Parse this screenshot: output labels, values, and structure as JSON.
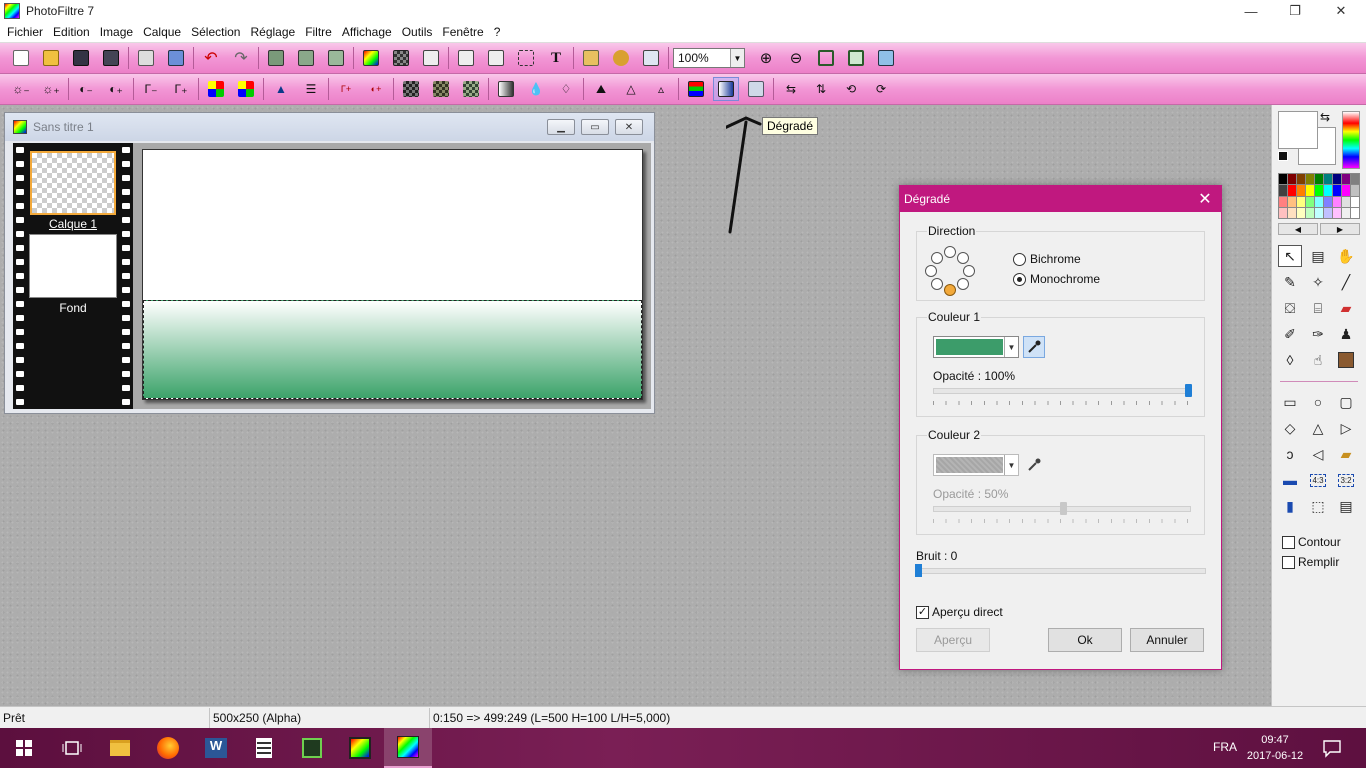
{
  "window": {
    "title": "PhotoFiltre 7",
    "minimize_glyph": "—",
    "restore_glyph": "❐",
    "close_glyph": "✕"
  },
  "menu": [
    "Fichier",
    "Edition",
    "Image",
    "Calque",
    "Sélection",
    "Réglage",
    "Filtre",
    "Affichage",
    "Outils",
    "Fenêtre",
    "?"
  ],
  "toolbar": {
    "zoom_value": "100%"
  },
  "document": {
    "title": "Sans titre 1",
    "layers": [
      {
        "name": "Calque 1",
        "selected": true
      },
      {
        "name": "Fond",
        "selected": false
      }
    ],
    "gradient_color": "#3ca36a"
  },
  "tooltip": "Dégradé",
  "dialog": {
    "title": "Dégradé",
    "direction": {
      "label": "Direction",
      "options": [
        "Bichrome",
        "Monochrome"
      ],
      "selected": "Monochrome"
    },
    "couleur1": {
      "label": "Couleur 1",
      "color": "#3c9c6a",
      "opacity_label": "Opacité : 100%",
      "opacity": 100
    },
    "couleur2": {
      "label": "Couleur 2",
      "color": "#b4b4b4",
      "opacity_label": "Opacité : 50%",
      "opacity": 50
    },
    "bruit": {
      "label": "Bruit : 0",
      "value": 0
    },
    "apercu_direct": {
      "label": "Aperçu direct",
      "checked": true
    },
    "buttons": {
      "apercu": "Aperçu",
      "ok": "Ok",
      "annuler": "Annuler"
    }
  },
  "tools_panel": {
    "contour": {
      "label": "Contour",
      "checked": false
    },
    "remplir": {
      "label": "Remplir",
      "checked": false
    }
  },
  "statusbar": {
    "state": "Prêt",
    "image_size": "500x250 (Alpha)",
    "selection_info": "0:150 => 499:249 (L=500  H=100  L/H=5,000)"
  },
  "taskbar": {
    "lang": "FRA",
    "time": "09:47",
    "date": "2017-06-12"
  },
  "colors": {
    "accent": "#c0187f",
    "toolbar_pink": "#f296d5",
    "taskbar": "#6a164a"
  }
}
